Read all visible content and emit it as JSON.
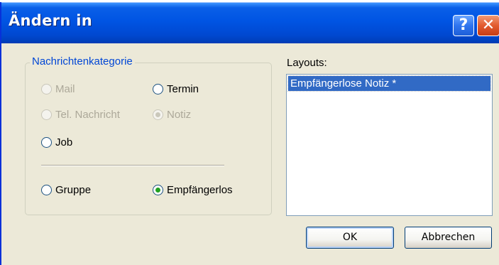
{
  "window": {
    "title": "Ändern in",
    "help_label": "?",
    "close_label": "✕"
  },
  "category_group": {
    "legend": "Nachrichtenkategorie",
    "options": [
      {
        "label": "Mail",
        "enabled": false,
        "checked": false
      },
      {
        "label": "Termin",
        "enabled": true,
        "checked": false
      },
      {
        "label": "Tel. Nachricht",
        "enabled": false,
        "checked": false
      },
      {
        "label": "Notiz",
        "enabled": false,
        "checked": true
      },
      {
        "label": "Job",
        "enabled": true,
        "checked": false
      }
    ],
    "recipient_options": [
      {
        "label": "Gruppe",
        "enabled": true,
        "checked": false
      },
      {
        "label": "Empfängerlos",
        "enabled": true,
        "checked": true
      }
    ]
  },
  "layouts": {
    "label": "Layouts:",
    "items": [
      {
        "label": "Empfängerlose Notiz *",
        "selected": true
      }
    ]
  },
  "buttons": {
    "ok": "OK",
    "cancel": "Abbrechen"
  },
  "colors": {
    "titlebar": "#0054e3",
    "group_legend": "#0046d5",
    "selection": "#316ac5",
    "radio_dot": "#21a121",
    "dialog_bg": "#ece9d8"
  }
}
